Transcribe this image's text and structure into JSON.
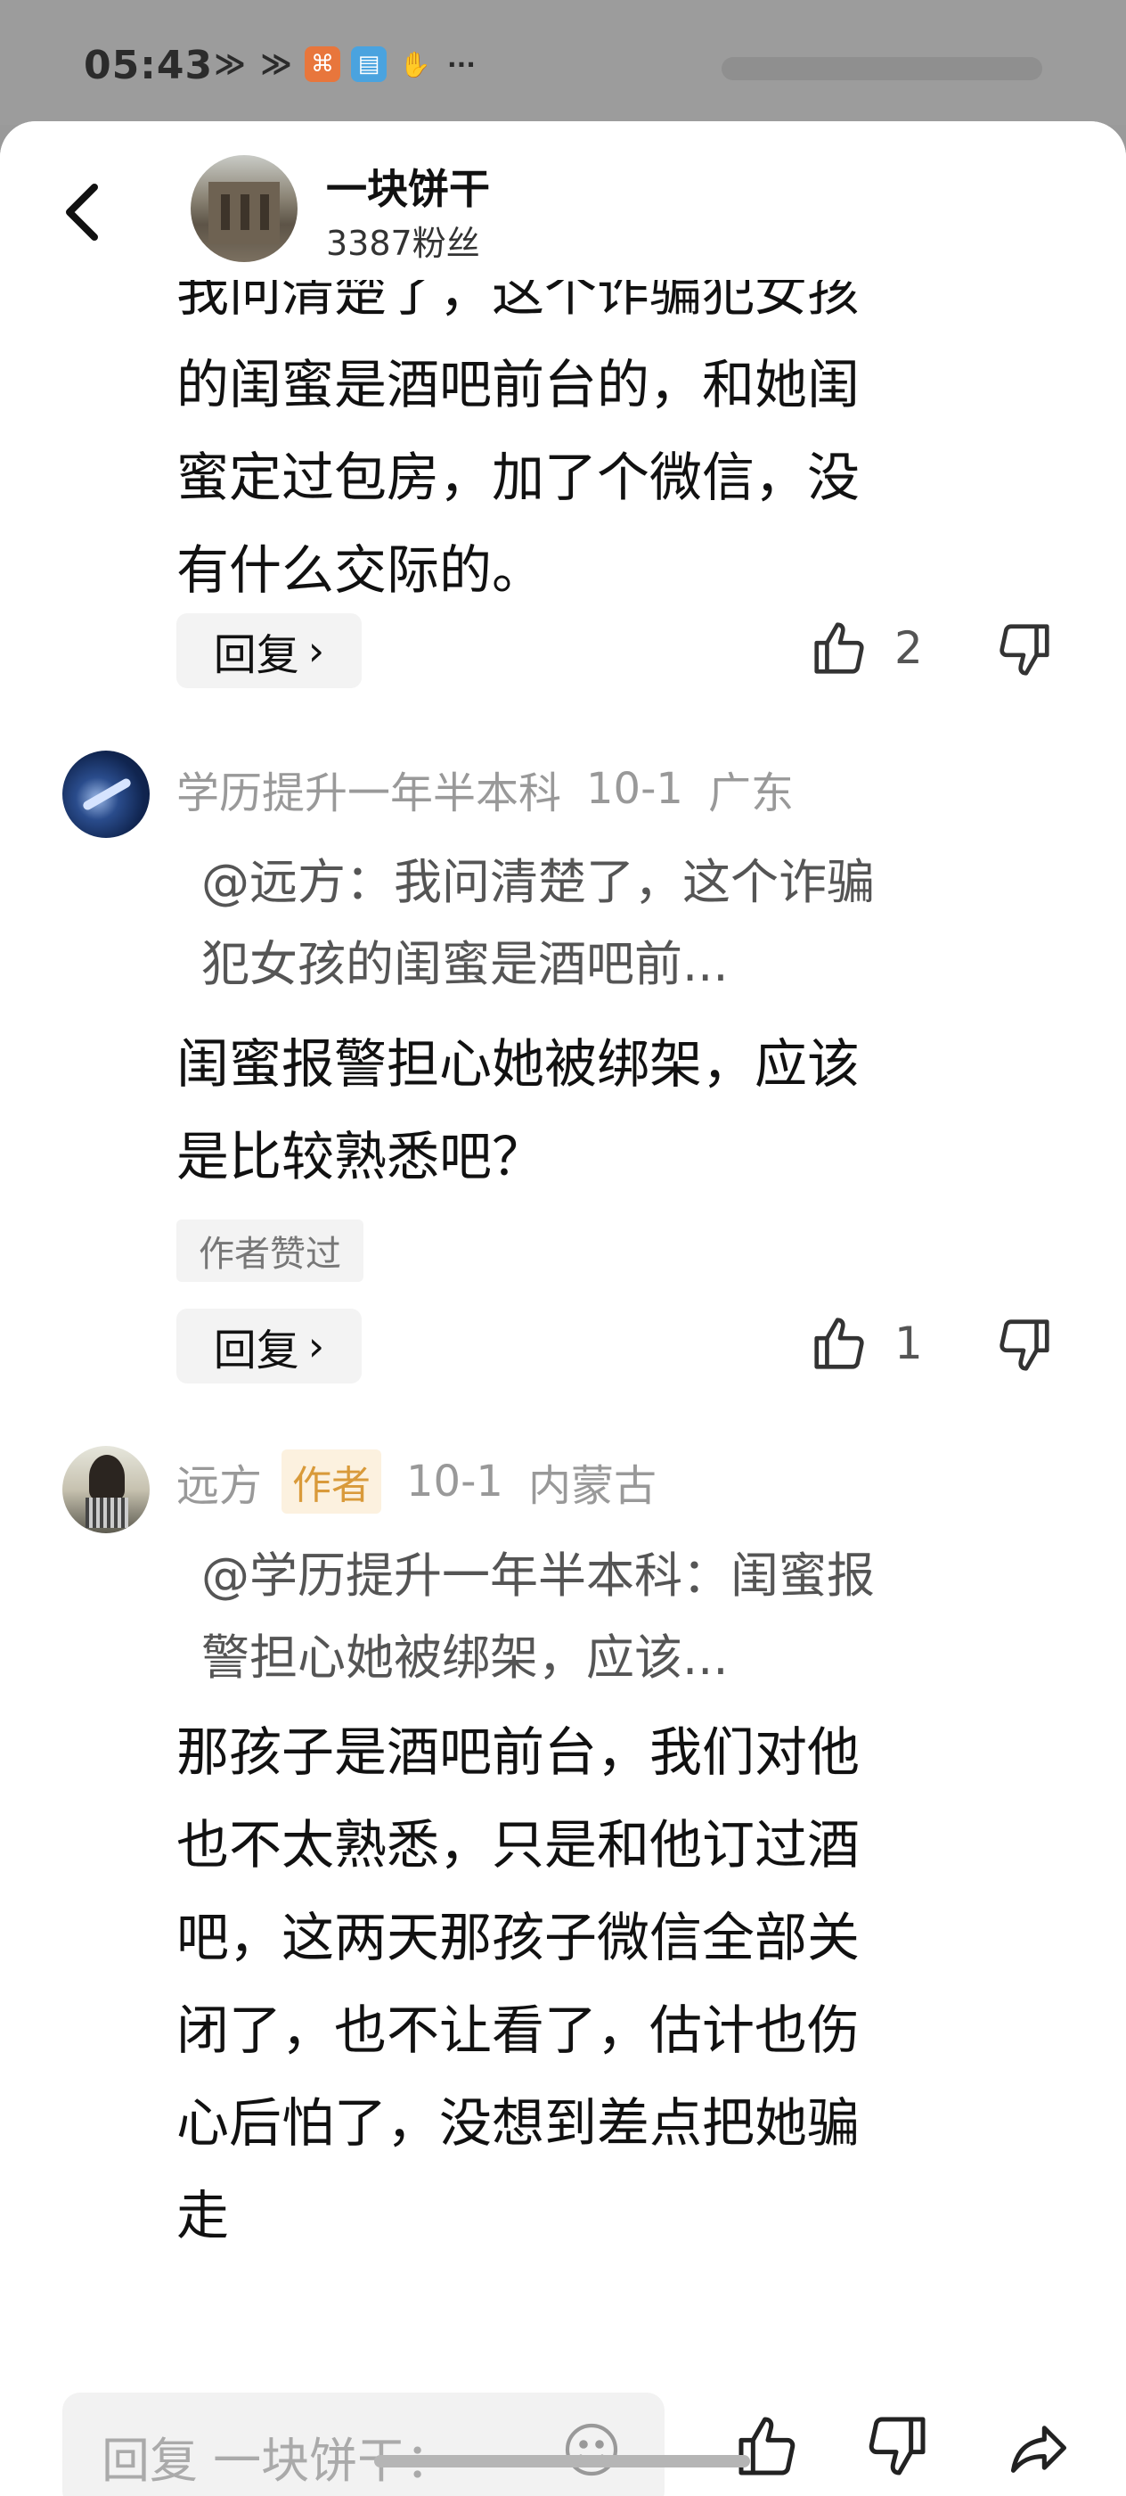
{
  "status_bar": {
    "time": "05:43",
    "icons": [
      "signal-icon",
      "signal-icon",
      "kuaishou-icon",
      "book-icon",
      "hand-icon",
      "more-icon"
    ]
  },
  "header": {
    "author_name": "一块饼干",
    "fans": "3387粉丝"
  },
  "comments": [
    {
      "partial_lines": [
        "我问清楚了，这个诈骗犯女孩",
        "的闺蜜是酒吧前台的，和她闺",
        "蜜定过包房，加了个微信，没",
        "有什么交际的。"
      ],
      "reply_label": "回复",
      "likes": "2"
    },
    {
      "user": "学历提升一年半本科",
      "date": "10-1",
      "location": "广东",
      "quote_lines": [
        "@远方：我问清楚了，这个诈骗",
        "犯女孩的闺蜜是酒吧前..."
      ],
      "text_lines": [
        "闺蜜报警担心她被绑架，应该",
        "是比较熟悉吧？"
      ],
      "tag": "作者赞过",
      "reply_label": "回复",
      "likes": "1"
    },
    {
      "user": "远方",
      "author_tag": "作者",
      "date": "10-1",
      "location": "内蒙古",
      "quote_lines": [
        "@学历提升一年半本科：闺蜜报",
        "警担心她被绑架，应该..."
      ],
      "text_lines": [
        "那孩子是酒吧前台，我们对他",
        "也不太熟悉，只是和他订过酒",
        "吧，这两天那孩子微信全部关",
        "闭了，也不让看了，估计也伤",
        "心后怕了，没想到差点把她骗",
        "走"
      ]
    }
  ],
  "bottom_bar": {
    "reply_placeholder": "回复 一块饼干："
  },
  "colors": {
    "background": "#ffffff",
    "meta_text": "#999999",
    "author_tag_bg": "#fcf1df",
    "author_tag_text": "#d99a3a"
  }
}
